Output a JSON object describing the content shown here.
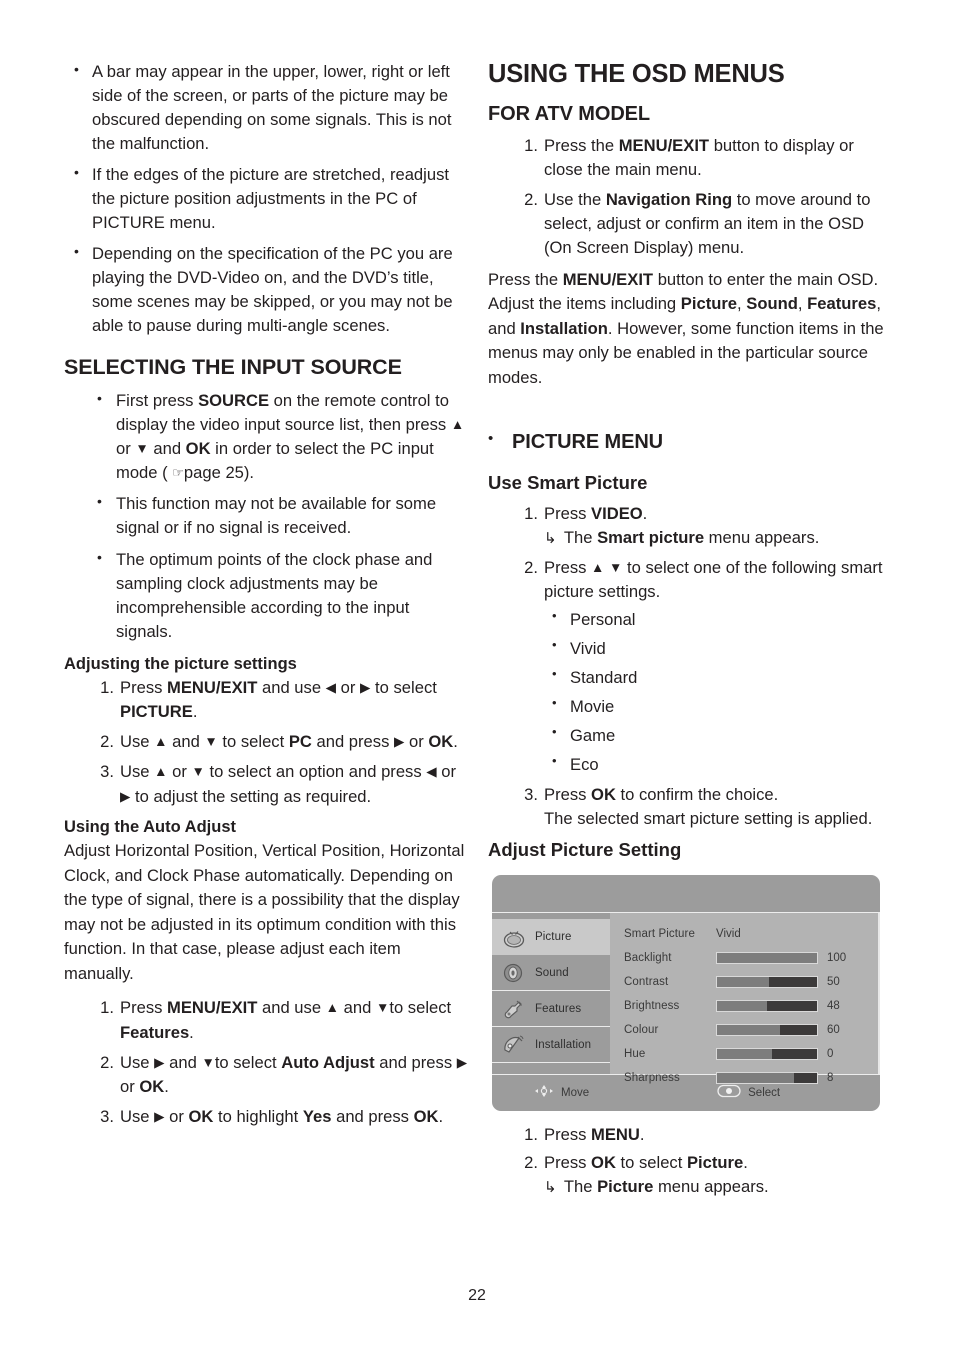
{
  "page": {
    "number": "22"
  },
  "left_column": {
    "intro_bullets": [
      "A bar may appear in the upper, lower, right or left side of the screen, or parts of the picture may be obscured depending on some signals. This is not the malfunction.",
      "If the edges of the picture are stretched, readjust the picture position adjustments in the PC of PICTURE menu.",
      "Depending on the specification of the PC you are playing the DVD-Video on, and the DVD’s title, some scenes may be skipped, or you may not be able to pause during multi-angle scenes."
    ],
    "selecting_input_source": {
      "heading": "SELECTING THE INPUT SOURCE",
      "bullet1_part1": "First press ",
      "bullet1_bold1": "SOURCE",
      "bullet1_part2": " on the remote control to display the video input source list, then press ",
      "bullet1_up": "▲",
      "bullet1_mid": " or ",
      "bullet1_down": "▼",
      "bullet1_part3": " and ",
      "bullet1_bold2": "OK",
      "bullet1_part4": " in order to select the PC input mode ( ",
      "bullet1_hand": "☞",
      "bullet1_part5": "page 25).",
      "bullet2": "This function may not be available for some signal or if no signal is received.",
      "bullet3": "The optimum points of the clock phase and sampling clock adjustments may be incomprehensible according to the input signals."
    },
    "adjusting_picture_settings": {
      "heading": "Adjusting the picture settings",
      "step1": {
        "t1": "Press ",
        "b1": "MENU/EXIT",
        "t2": " and use ",
        "left": "◀",
        "t3": " or ",
        "right": "▶",
        "t4": " to select ",
        "b2": "PICTURE",
        "t5": "."
      },
      "step2": {
        "t1": "Use ",
        "up": "▲",
        "t2": " and ",
        "down": "▼",
        "t3": " to select ",
        "b1": "PC",
        "t4": " and press ",
        "right": "▶",
        "t5": " or ",
        "b2": "OK",
        "t6": "."
      },
      "step3": {
        "t1": "Use ",
        "up": "▲",
        "t2": " or ",
        "down": "▼",
        "t3": " to select an option and press ",
        "left": "◀",
        "t4": " or ",
        "right": "▶",
        "t5": " to adjust the setting as required."
      }
    },
    "using_auto_adjust": {
      "heading": "Using the Auto Adjust",
      "paragraph": "Adjust Horizontal Position, Vertical Position, Horizontal Clock, and Clock Phase automatically. Depending on the type of signal, there is a possibility that the display may not be adjusted in its optimum condition with this function. In that case, please adjust each item manually.",
      "step1": {
        "t1": "Press ",
        "b1": "MENU/EXIT",
        "t2": " and use ",
        "up": "▲",
        "t3": " and ",
        "down": "▼",
        "t4": "to select ",
        "b2": "Features",
        "t5": "."
      },
      "step2": {
        "t1": "Use ",
        "right": "▶",
        "t2": " and ",
        "down": "▼",
        "t3": "to select ",
        "b1": "Auto Adjust",
        "t4": " and press ",
        "right2": "▶",
        "t5": " or ",
        "b2": "OK",
        "t6": "."
      },
      "step3": {
        "t1": "Use ",
        "right": "▶",
        "t2": " or ",
        "b1": "OK",
        "t3": " to highlight ",
        "b2": "Yes",
        "t4": " and press ",
        "b3": "OK",
        "t5": "."
      }
    }
  },
  "right_column": {
    "title": "USING THE OSD MENUS",
    "for_atv_model": {
      "heading": "FOR ATV MODEL",
      "step1": {
        "t1": "Press the ",
        "b1": "MENU/EXIT",
        "t2": " button to display or close the main menu."
      },
      "step2": {
        "t1": "Use the ",
        "b1": "Navigation Ring",
        "t2": " to move around to select, adjust or confirm an item in the OSD (On Screen Display) menu."
      },
      "paragraph": {
        "t1": "Press the ",
        "b1": "MENU/EXIT",
        "t2": " button to enter the main OSD. Adjust the items including ",
        "b2": "Picture",
        "t3": ", ",
        "b3": "Sound",
        "t4": ", ",
        "b4": "Features",
        "t5": ", and ",
        "b5": "Installation",
        "t6": ". However, some function items in the menus may only be enabled in the particular source modes."
      }
    },
    "picture_menu": {
      "heading": "PICTURE MENU",
      "use_smart_picture": {
        "heading": "Use Smart Picture",
        "step1": {
          "t1": "Press ",
          "b1": "VIDEO",
          "t2": ".",
          "hook": "↳",
          "sub_t1": " The ",
          "sub_b1": "Smart picture",
          "sub_t2": " menu appears."
        },
        "step2": {
          "t1": "Press ",
          "up": "▲",
          "down": "▼",
          "t2": " to select one of the following smart picture settings."
        },
        "settings": [
          "Personal",
          "Vivid",
          "Standard",
          "Movie",
          "Game",
          "Eco"
        ],
        "step3": {
          "t1": "Press ",
          "b1": "OK",
          "t2": " to confirm the choice.",
          "line2": "The selected smart picture setting is applied."
        }
      },
      "adjust_picture_setting": {
        "heading": "Adjust Picture Setting",
        "step1": {
          "t1": "Press ",
          "b1": "MENU",
          "t2": "."
        },
        "step2": {
          "t1": "Press ",
          "b1": "OK",
          "t2": " to select ",
          "b2": "Picture",
          "t3": ".",
          "hook": "↳",
          "sub_t1": " The ",
          "sub_b1": "Picture",
          "sub_t2": " menu appears."
        }
      }
    }
  },
  "osd": {
    "sidebar": [
      {
        "label": "Picture",
        "icon": "tv-icon",
        "active": true
      },
      {
        "label": "Sound",
        "icon": "speaker-icon",
        "active": false
      },
      {
        "label": "Features",
        "icon": "wrench-icon",
        "active": false
      },
      {
        "label": "Installation",
        "icon": "satellite-dish-icon",
        "active": false
      }
    ],
    "rows": [
      {
        "label": "Smart Picture",
        "type": "text",
        "value": "Vivid"
      },
      {
        "label": "Backlight",
        "type": "slider",
        "value": "100",
        "fill_pct": 100
      },
      {
        "label": "Contrast",
        "type": "slider",
        "value": "50",
        "fill_pct": 52
      },
      {
        "label": "Brightness",
        "type": "slider",
        "value": "48",
        "fill_pct": 50
      },
      {
        "label": "Colour",
        "type": "slider",
        "value": "60",
        "fill_pct": 63
      },
      {
        "label": "Hue",
        "type": "slider",
        "value": "0",
        "fill_pct": 55
      },
      {
        "label": "Sharpness",
        "type": "slider",
        "value": "8",
        "fill_pct": 77
      }
    ],
    "footer": {
      "move_label": "Move",
      "select_label": "Select"
    },
    "colors": {
      "frame": "#9c9c9c",
      "panel": "#b3b3b3",
      "active_row": "#c9c9c9",
      "bar_track": "#3c3a3a",
      "bar_fill": "#7d7d7d"
    }
  }
}
